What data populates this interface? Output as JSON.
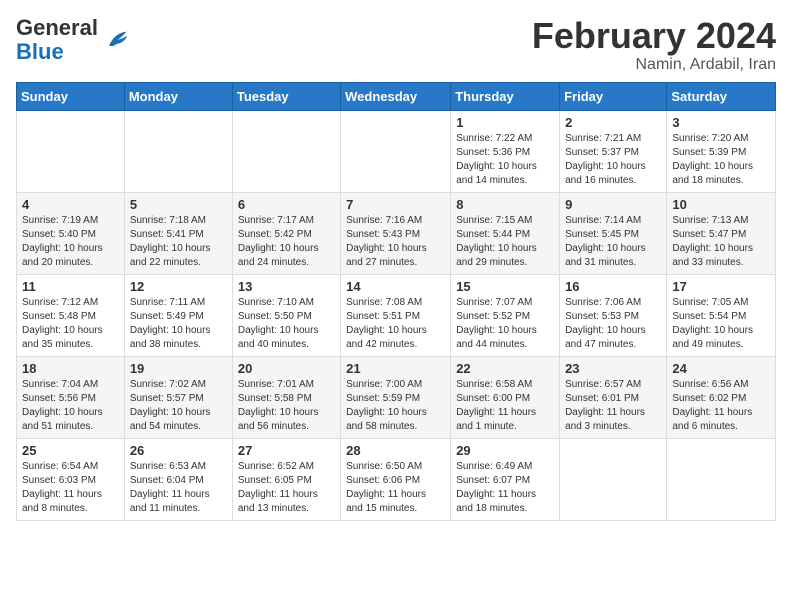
{
  "header": {
    "logo_general": "General",
    "logo_blue": "Blue",
    "month_year": "February 2024",
    "location": "Namin, Ardabil, Iran"
  },
  "weekdays": [
    "Sunday",
    "Monday",
    "Tuesday",
    "Wednesday",
    "Thursday",
    "Friday",
    "Saturday"
  ],
  "weeks": [
    [
      {
        "day": "",
        "detail": ""
      },
      {
        "day": "",
        "detail": ""
      },
      {
        "day": "",
        "detail": ""
      },
      {
        "day": "",
        "detail": ""
      },
      {
        "day": "1",
        "detail": "Sunrise: 7:22 AM\nSunset: 5:36 PM\nDaylight: 10 hours\nand 14 minutes."
      },
      {
        "day": "2",
        "detail": "Sunrise: 7:21 AM\nSunset: 5:37 PM\nDaylight: 10 hours\nand 16 minutes."
      },
      {
        "day": "3",
        "detail": "Sunrise: 7:20 AM\nSunset: 5:39 PM\nDaylight: 10 hours\nand 18 minutes."
      }
    ],
    [
      {
        "day": "4",
        "detail": "Sunrise: 7:19 AM\nSunset: 5:40 PM\nDaylight: 10 hours\nand 20 minutes."
      },
      {
        "day": "5",
        "detail": "Sunrise: 7:18 AM\nSunset: 5:41 PM\nDaylight: 10 hours\nand 22 minutes."
      },
      {
        "day": "6",
        "detail": "Sunrise: 7:17 AM\nSunset: 5:42 PM\nDaylight: 10 hours\nand 24 minutes."
      },
      {
        "day": "7",
        "detail": "Sunrise: 7:16 AM\nSunset: 5:43 PM\nDaylight: 10 hours\nand 27 minutes."
      },
      {
        "day": "8",
        "detail": "Sunrise: 7:15 AM\nSunset: 5:44 PM\nDaylight: 10 hours\nand 29 minutes."
      },
      {
        "day": "9",
        "detail": "Sunrise: 7:14 AM\nSunset: 5:45 PM\nDaylight: 10 hours\nand 31 minutes."
      },
      {
        "day": "10",
        "detail": "Sunrise: 7:13 AM\nSunset: 5:47 PM\nDaylight: 10 hours\nand 33 minutes."
      }
    ],
    [
      {
        "day": "11",
        "detail": "Sunrise: 7:12 AM\nSunset: 5:48 PM\nDaylight: 10 hours\nand 35 minutes."
      },
      {
        "day": "12",
        "detail": "Sunrise: 7:11 AM\nSunset: 5:49 PM\nDaylight: 10 hours\nand 38 minutes."
      },
      {
        "day": "13",
        "detail": "Sunrise: 7:10 AM\nSunset: 5:50 PM\nDaylight: 10 hours\nand 40 minutes."
      },
      {
        "day": "14",
        "detail": "Sunrise: 7:08 AM\nSunset: 5:51 PM\nDaylight: 10 hours\nand 42 minutes."
      },
      {
        "day": "15",
        "detail": "Sunrise: 7:07 AM\nSunset: 5:52 PM\nDaylight: 10 hours\nand 44 minutes."
      },
      {
        "day": "16",
        "detail": "Sunrise: 7:06 AM\nSunset: 5:53 PM\nDaylight: 10 hours\nand 47 minutes."
      },
      {
        "day": "17",
        "detail": "Sunrise: 7:05 AM\nSunset: 5:54 PM\nDaylight: 10 hours\nand 49 minutes."
      }
    ],
    [
      {
        "day": "18",
        "detail": "Sunrise: 7:04 AM\nSunset: 5:56 PM\nDaylight: 10 hours\nand 51 minutes."
      },
      {
        "day": "19",
        "detail": "Sunrise: 7:02 AM\nSunset: 5:57 PM\nDaylight: 10 hours\nand 54 minutes."
      },
      {
        "day": "20",
        "detail": "Sunrise: 7:01 AM\nSunset: 5:58 PM\nDaylight: 10 hours\nand 56 minutes."
      },
      {
        "day": "21",
        "detail": "Sunrise: 7:00 AM\nSunset: 5:59 PM\nDaylight: 10 hours\nand 58 minutes."
      },
      {
        "day": "22",
        "detail": "Sunrise: 6:58 AM\nSunset: 6:00 PM\nDaylight: 11 hours\nand 1 minute."
      },
      {
        "day": "23",
        "detail": "Sunrise: 6:57 AM\nSunset: 6:01 PM\nDaylight: 11 hours\nand 3 minutes."
      },
      {
        "day": "24",
        "detail": "Sunrise: 6:56 AM\nSunset: 6:02 PM\nDaylight: 11 hours\nand 6 minutes."
      }
    ],
    [
      {
        "day": "25",
        "detail": "Sunrise: 6:54 AM\nSunset: 6:03 PM\nDaylight: 11 hours\nand 8 minutes."
      },
      {
        "day": "26",
        "detail": "Sunrise: 6:53 AM\nSunset: 6:04 PM\nDaylight: 11 hours\nand 11 minutes."
      },
      {
        "day": "27",
        "detail": "Sunrise: 6:52 AM\nSunset: 6:05 PM\nDaylight: 11 hours\nand 13 minutes."
      },
      {
        "day": "28",
        "detail": "Sunrise: 6:50 AM\nSunset: 6:06 PM\nDaylight: 11 hours\nand 15 minutes."
      },
      {
        "day": "29",
        "detail": "Sunrise: 6:49 AM\nSunset: 6:07 PM\nDaylight: 11 hours\nand 18 minutes."
      },
      {
        "day": "",
        "detail": ""
      },
      {
        "day": "",
        "detail": ""
      }
    ]
  ]
}
